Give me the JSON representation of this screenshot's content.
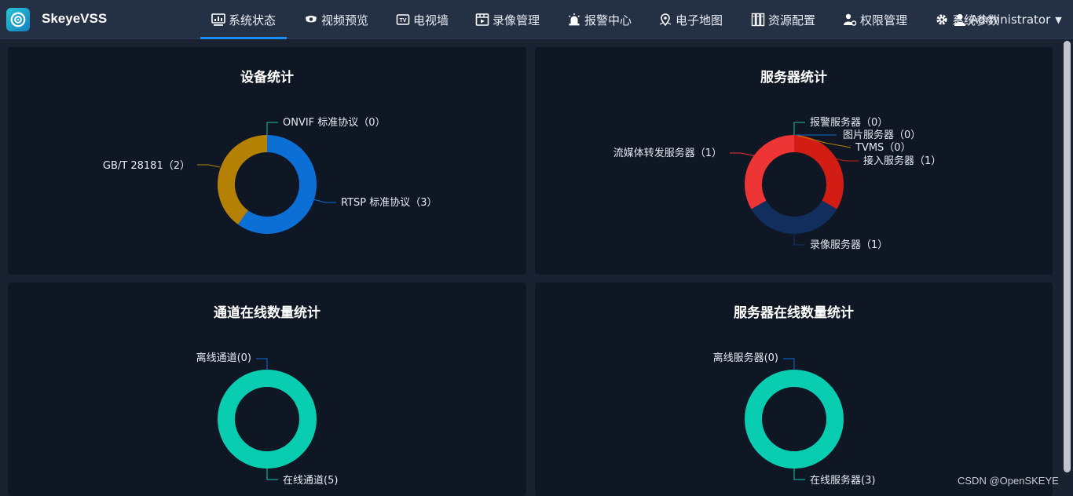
{
  "app": {
    "brand": "SkeyeVSS"
  },
  "nav": [
    {
      "label": "系统状态",
      "icon": "monitor-chart-icon",
      "active": true
    },
    {
      "label": "视频预览",
      "icon": "camera-icon"
    },
    {
      "label": "电视墙",
      "icon": "tv-icon"
    },
    {
      "label": "录像管理",
      "icon": "film-icon"
    },
    {
      "label": "报警中心",
      "icon": "alarm-light-icon"
    },
    {
      "label": "电子地图",
      "icon": "map-pin-icon"
    },
    {
      "label": "资源配置",
      "icon": "server-rack-icon"
    },
    {
      "label": "权限管理",
      "icon": "user-gear-icon"
    },
    {
      "label": "系统参数",
      "icon": "gear-icon"
    }
  ],
  "user": {
    "name": "Administrator",
    "icon": "user-icon"
  },
  "panels": {
    "device": {
      "title": "设备统计"
    },
    "server": {
      "title": "服务器统计"
    },
    "channel_online": {
      "title": "通道在线数量统计"
    },
    "server_online": {
      "title": "服务器在线数量统计"
    }
  },
  "chart_data": [
    {
      "type": "pie",
      "title": "设备统计",
      "categories": [
        "ONVIF 标准协议",
        "RTSP 标准协议",
        "GB/T 28181"
      ],
      "values": [
        0,
        3,
        2
      ],
      "labels": [
        "ONVIF 标准协议（0）",
        "RTSP 标准协议（3）",
        "GB/T 28181（2）"
      ],
      "colors": [
        "#1dbfa2",
        "#0b6fd6",
        "#b58105"
      ]
    },
    {
      "type": "pie",
      "title": "服务器统计",
      "categories": [
        "报警服务器",
        "图片服务器",
        "TVMS",
        "接入服务器",
        "录像服务器",
        "流媒体转发服务器"
      ],
      "values": [
        0,
        0,
        0,
        1,
        1,
        1
      ],
      "labels": [
        "报警服务器（0）",
        "图片服务器（0）",
        "TVMS（0）",
        "接入服务器（1）",
        "录像服务器（1）",
        "流媒体转发服务器（1）"
      ],
      "colors": [
        "#1dbfa2",
        "#0b6fd6",
        "#b58105",
        "#d11d14",
        "#112e5c",
        "#ee3535"
      ]
    },
    {
      "type": "pie",
      "title": "通道在线数量统计",
      "categories": [
        "离线通道",
        "在线通道"
      ],
      "values": [
        0,
        5
      ],
      "labels": [
        "离线通道(0)",
        "在线通道(5)"
      ],
      "colors": [
        "#0b6fd6",
        "#08cdb0"
      ]
    },
    {
      "type": "pie",
      "title": "服务器在线数量统计",
      "categories": [
        "离线服务器",
        "在线服务器"
      ],
      "values": [
        0,
        3
      ],
      "labels": [
        "离线服务器(0)",
        "在线服务器(3)"
      ],
      "colors": [
        "#0b6fd6",
        "#08cdb0"
      ]
    }
  ],
  "watermark": "CSDN @OpenSKEYE"
}
